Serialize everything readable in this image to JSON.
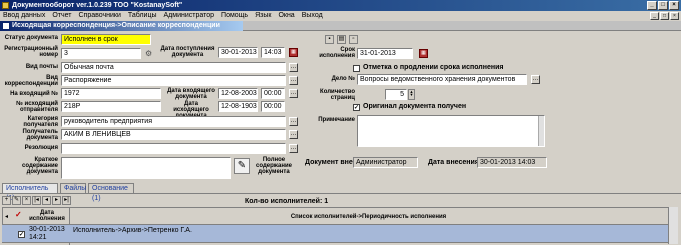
{
  "window": {
    "title": "Документооборот ver.1.0.239 ТОО \"KostanaySoft\""
  },
  "menu": [
    "Ввод данных",
    "Отчет",
    "Справочники",
    "Таблицы",
    "Администратор",
    "Помощь",
    "Язык",
    "Окна",
    "Выход"
  ],
  "form": {
    "title": "Исходящая корреспонденция->Описание корреспонденции"
  },
  "left": {
    "status_label": "Статус документа",
    "status_value": "Исполнен в срок",
    "regnum_label": "Регистрационный номер",
    "regnum_value": "3",
    "date_in_label": "Дата поступления документа",
    "date_in_value": "30-01-2013",
    "time_in_value": "14:03",
    "mail_label": "Вид почты",
    "mail_value": "Обычная почта",
    "corr_label": "Вид корреспонденции",
    "corr_value": "Распоряжение",
    "innum_label": "На входящий №",
    "innum_value": "1972",
    "date_incoming_label": "Дата входящего документа",
    "date_incoming_value": "12-08-2003",
    "time_incoming_value": "00:00",
    "outnum_label": "№ исходящий отправителя",
    "outnum_value": "218Р",
    "date_outgoing_label": "Дата исходящего документа",
    "date_outgoing_value": "12-08-1903",
    "time_outgoing_value": "00:00",
    "category_label": "Категория получателя",
    "category_value": "руководитель предприятия",
    "recipient_label": "Получатель документа",
    "recipient_value": "АКИМ В ЛЕНИВЦЕВ",
    "resolution_label": "Резолюция",
    "resolution_value": "",
    "summary_label": "Краткое содержание документа",
    "summary_value": "",
    "full_content_label": "Полное содержание документа"
  },
  "right": {
    "deadline_label": "Срок исполнения",
    "deadline_value": "31-01-2013",
    "extend_label": "Отметка о продлении срока исполнения",
    "case_label": "Дело №",
    "case_value": "Вопросы ведомственного хранения документов",
    "pages_label": "Количество страниц",
    "pages_value": "5",
    "original_label": "Оригинал документа получен",
    "note_label": "Примечание",
    "note_value": "",
    "author_label": "Документ внес",
    "author_value": "Администратор",
    "entry_date_label": "Дата внесения",
    "entry_date_value": "30-01-2013 14:03"
  },
  "tabs": [
    "Исполнитель (1)",
    "Файлы",
    "Основание (1)"
  ],
  "grid": {
    "count_label": "Кол-во исполнителей: 1",
    "col_date": "Дата исполнения",
    "col_list": "Список исполнителей->Периодичность исполнения",
    "rows": [
      {
        "date": "30-01-2013",
        "time": "14:21",
        "text": "Исполнитель->Архив->Петренко Г.А."
      }
    ]
  }
}
